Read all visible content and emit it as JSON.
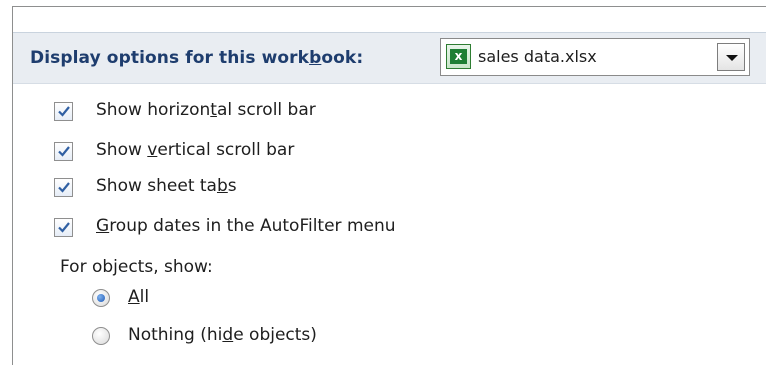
{
  "header": {
    "label_pre": "Display options for this work",
    "label_key": "b",
    "label_post": "ook:"
  },
  "workbook_select": {
    "icon": "excel-file-icon",
    "icon_glyph": "x",
    "value": "sales data.xlsx"
  },
  "checkboxes": [
    {
      "pre": "Show horizon",
      "key": "t",
      "post": "al scroll bar",
      "checked": true
    },
    {
      "pre": "Show ",
      "key": "v",
      "post": "ertical scroll bar",
      "checked": true
    },
    {
      "pre": "Show sheet ta",
      "key": "b",
      "post": "s",
      "checked": true
    },
    {
      "pre": "",
      "key": "G",
      "post": "roup dates in the AutoFilter menu",
      "checked": true
    }
  ],
  "objects_group": {
    "label": "For objects, show:",
    "options": [
      {
        "pre": "",
        "key": "A",
        "post": "ll",
        "selected": true
      },
      {
        "pre": "Nothing (hi",
        "key": "d",
        "post": "e objects)",
        "selected": false
      }
    ]
  },
  "colors": {
    "header_bg": "#e9edf2",
    "header_text": "#1e3d6e",
    "check_blue": "#2f5fa3",
    "radio_blue": "#1f5ab6"
  }
}
